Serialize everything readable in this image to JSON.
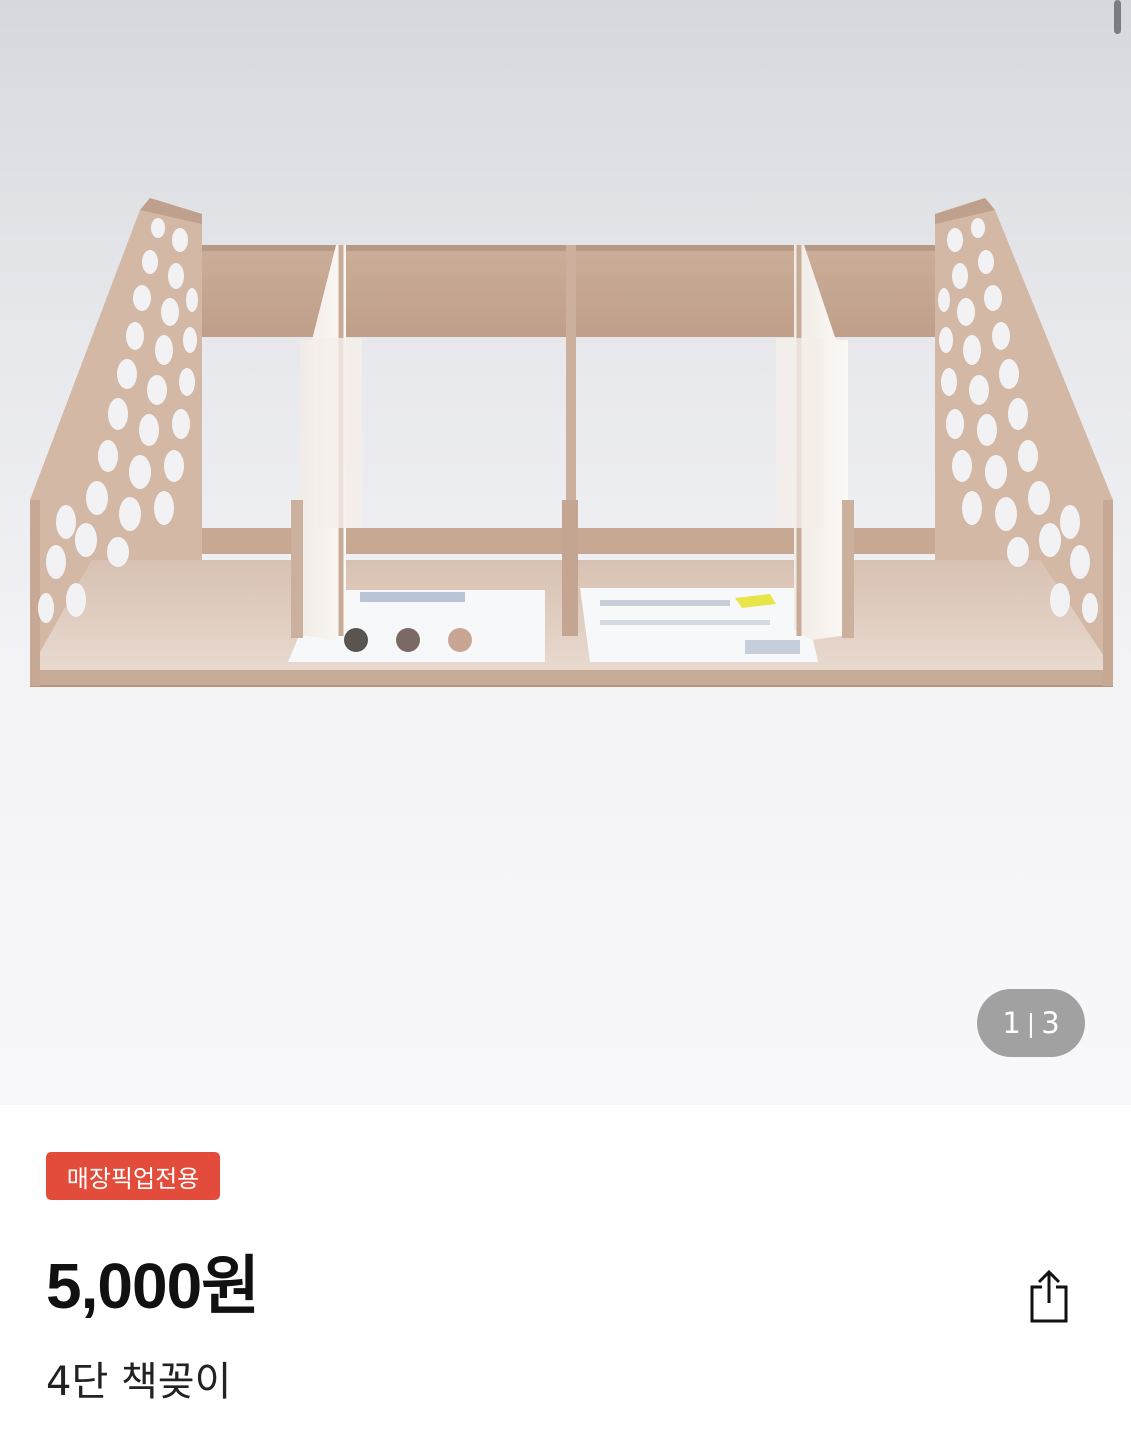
{
  "gallery": {
    "current_page": "1",
    "separator": "|",
    "total_pages": "3"
  },
  "product": {
    "badge": "매장픽업전용",
    "price": "5,000원",
    "name": "4단 책꽂이"
  },
  "icons": {
    "share": "share-icon"
  },
  "colors": {
    "badge_bg": "#e34c3a",
    "shelf_beige": "#c9a993",
    "counter_bg": "#808080"
  }
}
